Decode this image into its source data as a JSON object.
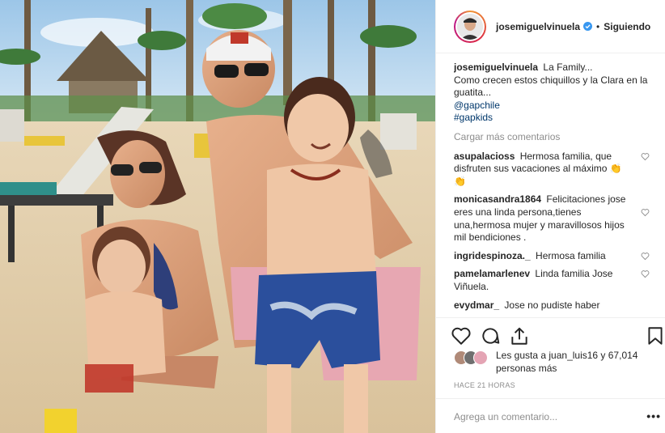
{
  "post": {
    "author": "josemiguelvinuela",
    "verified": true,
    "follow_label": "Siguiendo",
    "dot": "•",
    "caption_text": "La Family...\nComo crecen estos chiquillos y la Clara en la guatita...",
    "caption_mention": "@gapchile",
    "caption_hashtag": "#gapkids",
    "load_more_label": "Cargar más comentarios",
    "liked_by_text": "Les gusta a juan_luis16 y 67,014 personas más",
    "timestamp": "HACE 21 HORAS",
    "comment_placeholder": "Agrega un comentario...",
    "more_label": "•••"
  },
  "comments": [
    {
      "user": "asupalacioss",
      "text": "Hermosa familia, que disfruten sus vacaciones al máximo 👏 👏"
    },
    {
      "user": "monicasandra1864",
      "text": "Felicitaciones jose eres una linda persona,tienes una,hermosa mujer y maravillosos hijos mil bendiciones ."
    },
    {
      "user": "ingridespinoza._",
      "text": "Hermosa familia"
    },
    {
      "user": "pamelamarlenev",
      "text": "Linda familia Jose Viñuela."
    },
    {
      "user": "evydmar_",
      "text": "Jose no pudiste haber"
    }
  ],
  "icons": {
    "verified": "verified-badge-icon",
    "like": "heart-icon",
    "comment": "comment-icon",
    "share": "share-icon",
    "save": "bookmark-icon",
    "comment_like": "heart-outline-icon"
  },
  "colors": {
    "text": "#262626",
    "muted": "#8e8e8e",
    "link": "#00376b",
    "verified": "#3897f0",
    "border": "#efefef"
  }
}
